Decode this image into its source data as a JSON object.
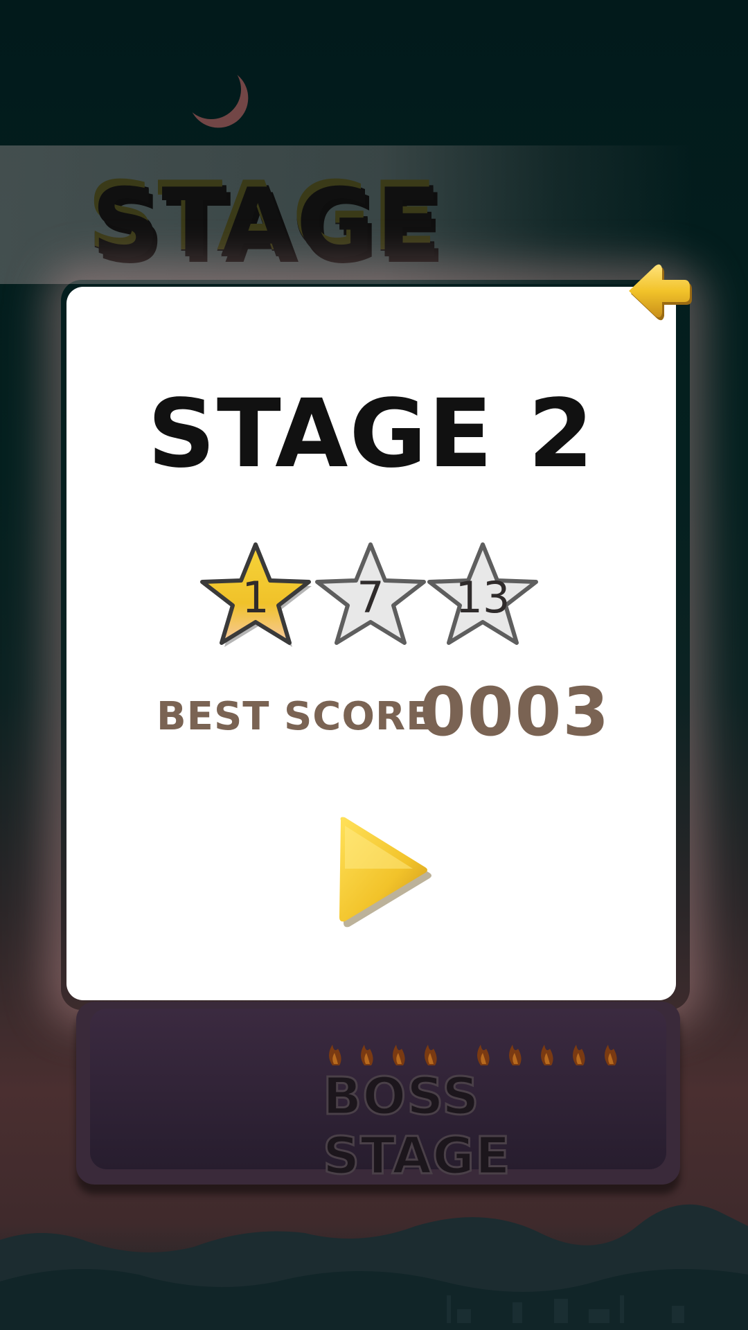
{
  "header": {
    "title": "STAGE"
  },
  "stage": {
    "title": "STAGE 2",
    "stars": [
      {
        "label": "1",
        "earned": true
      },
      {
        "label": "7",
        "earned": false
      },
      {
        "label": "13",
        "earned": false
      }
    ],
    "best_score_label": "BEST SCORE",
    "best_score_value": "0003"
  },
  "boss": {
    "label": "BOSS STAGE"
  },
  "colors": {
    "gold": "#f2c32a",
    "card": "#ffffff",
    "score_text": "#7a6353"
  },
  "icons": {
    "back": "left-arrow-icon",
    "play": "play-icon",
    "moon": "moon-icon",
    "star": "star-icon",
    "flame": "flame-icon"
  }
}
